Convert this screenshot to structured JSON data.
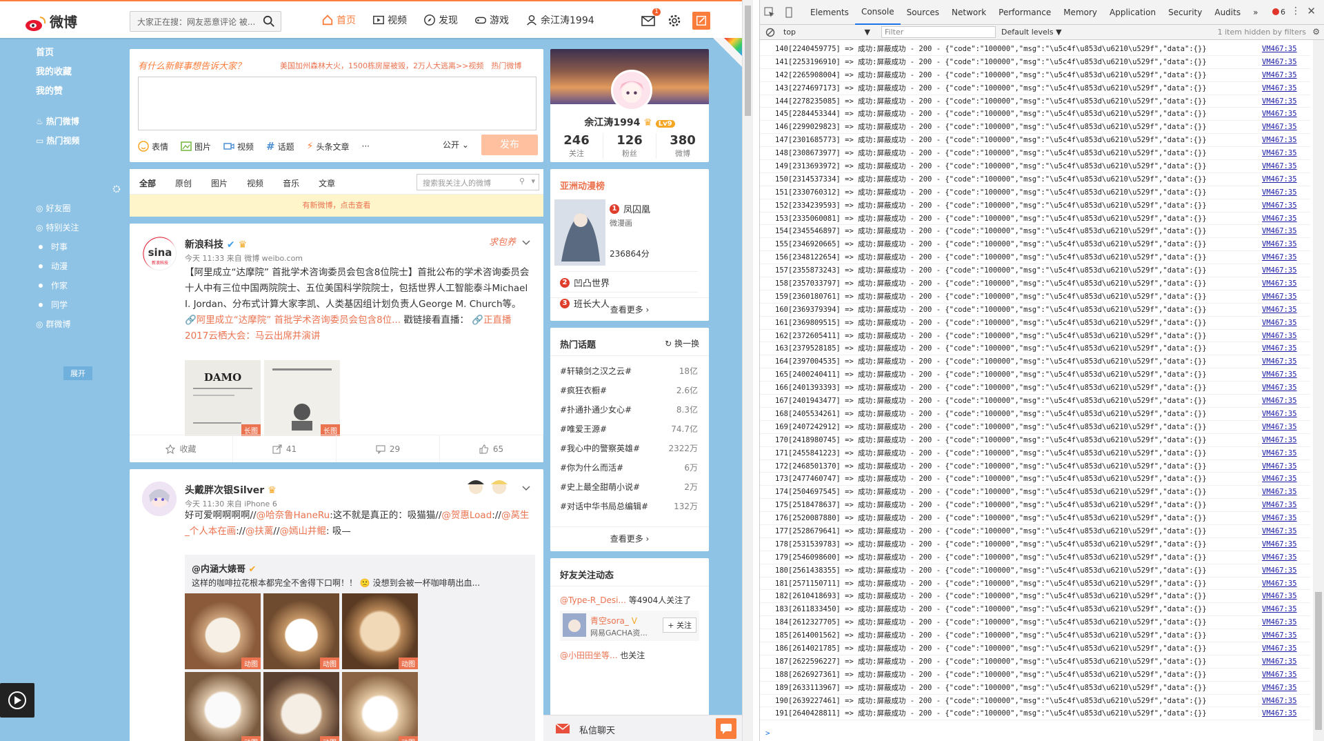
{
  "weibo": {
    "logo_text": "微博",
    "search_placeholder": "大家正在搜：网友恶意评论 被...",
    "nav": [
      "首页",
      "视频",
      "发现",
      "游戏",
      "余江涛1994"
    ],
    "mail_badge": "1",
    "accent": "#fa7d3c",
    "sidebar": {
      "main": [
        "首页",
        "我的收藏",
        "我的赞"
      ],
      "hot": [
        "热门微博",
        "热门视频"
      ],
      "groups": [
        "好友圈",
        "特别关注"
      ],
      "sub": [
        "时事",
        "动漫",
        "作家",
        "同学"
      ],
      "group_weibo": "群微博",
      "expand": "展开"
    },
    "compose": {
      "prompt": "有什么新鲜事想告诉大家？",
      "hot_line": "美国加州森林大火，1500栋房屋被毁，2万人大逃离>>视频　热门微博",
      "tools": [
        "表情",
        "图片",
        "视频",
        "话题",
        "头条文章",
        "···"
      ],
      "visibility": "公开",
      "send": "发布"
    },
    "feed_tabs": [
      "全部",
      "原创",
      "图片",
      "视频",
      "音乐",
      "文章"
    ],
    "feed_search_placeholder": "搜索我关注人的微博",
    "new_notice": "有新微博，点击查看",
    "posts": [
      {
        "name": "新浪科技",
        "avatar_text": "sina",
        "avatar_subtext": "新浪科技",
        "sticker": "求包养",
        "time": "今天 11:33 来自 微博 weibo.com",
        "text_a": "【阿里成立“达摩院” 首批学术咨询委员会包含8位院士】首批公布的学术咨询委员会十人中有三位中国两院院士、五位美国科学院院士，包括世界人工智能泰斗Michael I. Jordan、分布式计算大家李凯、人类基因组计划负责人George M. Church等。",
        "link1": "🔗阿里成立“达摩院” 首批学术咨询委员会包含8位...",
        "text_b": " 戳链接看直播：",
        "link2": "🔗正直播2017云栖大会：马云出席并演讲",
        "pic_title": "DAMO",
        "pic_tags": [
          "长图",
          "长图"
        ],
        "actions": [
          "收藏",
          "41",
          "29",
          "65"
        ]
      },
      {
        "name": "头戴胖次银Silver",
        "time": "今天 11:30 来自 iPhone 6",
        "text_a": "好可爱啊啊啊啊//",
        "m1": "@哈奈鲁HaneRu",
        "text_b": ":这不就是真正的：吸猫猫//",
        "m2": "@贺惠Load",
        "text_c": "://",
        "m3": "@莴生_个人本在画",
        "text_d": "://",
        "m4": "@扶蓠",
        "text_e": "//",
        "m5": "@嫣山井鲲",
        "text_f": ": 吸—",
        "repost_name": "@内涵大婊哥",
        "repost_text": "这样的咖啡拉花根本都完全不舍得下口啊！！ 🙁 没想到会被一杯咖啡萌出血...",
        "gif_tag": "动图"
      }
    ],
    "profile": {
      "name": "余江涛1994",
      "level": "Lv9",
      "follow": "246",
      "follow_label": "关注",
      "fans": "126",
      "fans_label": "粉丝",
      "posts": "380",
      "posts_label": "微博"
    },
    "anime": {
      "title": "亚洲动漫榜",
      "items": [
        {
          "rank": "1",
          "name": "凤囚凰",
          "sub": "微漫画",
          "score": "236864分"
        },
        {
          "rank": "2",
          "name": "凹凸世界"
        },
        {
          "rank": "3",
          "name": "班长大人"
        }
      ],
      "more": "查看更多 ›"
    },
    "topics": {
      "title": "热门话题",
      "refresh": "换一换",
      "items": [
        {
          "t": "#轩辕剑之汉之云#",
          "v": "18亿"
        },
        {
          "t": "#疯狂衣橱#",
          "v": "2.6亿"
        },
        {
          "t": "#扑通扑通少女心#",
          "v": "8.3亿"
        },
        {
          "t": "#唯爱王源#",
          "v": "74.7亿"
        },
        {
          "t": "#我心中的警察英雄#",
          "v": "2322万"
        },
        {
          "t": "#你为什么而活#",
          "v": "6万"
        },
        {
          "t": "#史上最全甜萌小说#",
          "v": "2万"
        },
        {
          "t": "#对话中华书局总编辑#",
          "v": "132万"
        }
      ],
      "more": "查看更多 ›"
    },
    "friends": {
      "title": "好友关注动态",
      "line1_user": "@Type-R_Desi...",
      "line1_text": "等4904人关注了",
      "card_name": "青空sora_",
      "card_sub": "网易GACHA资...",
      "follow_btn": "+ 关注",
      "line2_user": "@小田田坐等...",
      "line2_text": "也关注"
    },
    "chat": "私信聊天"
  },
  "devtools": {
    "tabs": [
      "Elements",
      "Console",
      "Sources",
      "Network",
      "Performance",
      "Memory",
      "Application",
      "Security",
      "Audits",
      "»"
    ],
    "active_tab": "Console",
    "errors": "6",
    "context": "top",
    "filter_placeholder": "Filter",
    "levels": "Default levels ▼",
    "hidden": "1 item hidden by filters",
    "logs": [
      {
        "i": "140",
        "id": "2240459775"
      },
      {
        "i": "141",
        "id": "2253196910"
      },
      {
        "i": "142",
        "id": "2265908004"
      },
      {
        "i": "143",
        "id": "2274697173"
      },
      {
        "i": "144",
        "id": "2278235085"
      },
      {
        "i": "145",
        "id": "2284453344"
      },
      {
        "i": "146",
        "id": "2299029823"
      },
      {
        "i": "147",
        "id": "2301685773"
      },
      {
        "i": "148",
        "id": "2308673977"
      },
      {
        "i": "149",
        "id": "2313693972"
      },
      {
        "i": "150",
        "id": "2314537334"
      },
      {
        "i": "151",
        "id": "2330760312"
      },
      {
        "i": "152",
        "id": "2334239593"
      },
      {
        "i": "153",
        "id": "2335060081"
      },
      {
        "i": "154",
        "id": "2345546897"
      },
      {
        "i": "155",
        "id": "2346920665"
      },
      {
        "i": "156",
        "id": "2348122654"
      },
      {
        "i": "157",
        "id": "2355873243"
      },
      {
        "i": "158",
        "id": "2357033797"
      },
      {
        "i": "159",
        "id": "2360180761"
      },
      {
        "i": "160",
        "id": "2369379394"
      },
      {
        "i": "161",
        "id": "2369809515"
      },
      {
        "i": "162",
        "id": "2372605411"
      },
      {
        "i": "163",
        "id": "2379528185"
      },
      {
        "i": "164",
        "id": "2397004535"
      },
      {
        "i": "165",
        "id": "2400240411"
      },
      {
        "i": "166",
        "id": "2401393393"
      },
      {
        "i": "167",
        "id": "2401943477"
      },
      {
        "i": "168",
        "id": "2405534261"
      },
      {
        "i": "169",
        "id": "2407242912"
      },
      {
        "i": "170",
        "id": "2418980745"
      },
      {
        "i": "171",
        "id": "2455841223"
      },
      {
        "i": "172",
        "id": "2468501370"
      },
      {
        "i": "173",
        "id": "2477460747"
      },
      {
        "i": "174",
        "id": "2504697545"
      },
      {
        "i": "175",
        "id": "2518478637"
      },
      {
        "i": "176",
        "id": "2520087880"
      },
      {
        "i": "177",
        "id": "2528679641"
      },
      {
        "i": "178",
        "id": "2531539783"
      },
      {
        "i": "179",
        "id": "2546098600"
      },
      {
        "i": "180",
        "id": "2561438355"
      },
      {
        "i": "181",
        "id": "2571150711"
      },
      {
        "i": "182",
        "id": "2610418693"
      },
      {
        "i": "183",
        "id": "2611833450"
      },
      {
        "i": "184",
        "id": "2612327705"
      },
      {
        "i": "185",
        "id": "2614001562"
      },
      {
        "i": "186",
        "id": "2614021785"
      },
      {
        "i": "187",
        "id": "2622596227"
      },
      {
        "i": "188",
        "id": "2626927361"
      },
      {
        "i": "189",
        "id": "2633113967"
      },
      {
        "i": "190",
        "id": "2639227461"
      },
      {
        "i": "191",
        "id": "2640428811"
      }
    ],
    "log_tail": " => 成功:屏蔽成功 - 200 - {\"code\":\"100000\",\"msg\":\"\\u5c4f\\u853d\\u6210\\u529f\",\"data\":{}}",
    "source": "VM467:35",
    "prompt": ">"
  }
}
